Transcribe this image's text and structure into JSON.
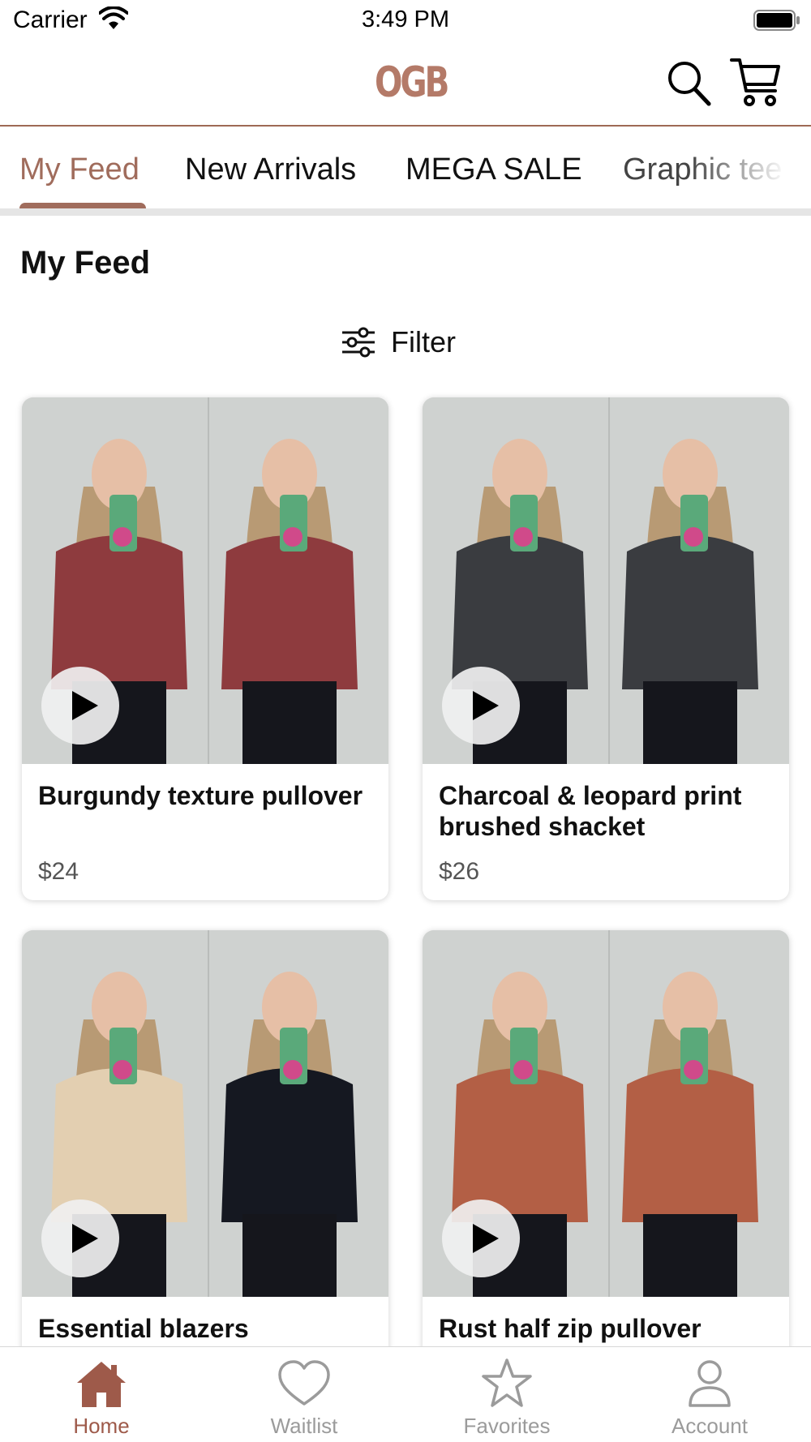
{
  "status_bar": {
    "carrier": "Carrier",
    "time": "3:49 PM"
  },
  "header": {
    "logo": "OGB",
    "brand_color": "#b47a68",
    "icons": [
      "search-icon",
      "cart-icon"
    ]
  },
  "tabs": [
    {
      "label": "My Feed",
      "active": true
    },
    {
      "label": "New Arrivals",
      "active": false
    },
    {
      "label": "MEGA SALE",
      "active": false
    },
    {
      "label": "Graphic tee",
      "active": false
    }
  ],
  "section_title": "My Feed",
  "filter": {
    "label": "Filter",
    "icon": "sliders-icon"
  },
  "products": [
    {
      "name": "Burgundy texture pullover",
      "price": "$24",
      "color": "#8e3b3e"
    },
    {
      "name": "Charcoal & leopard print brushed shacket",
      "price": "$26",
      "color": "#3a3c40"
    },
    {
      "name": "Essential blazers",
      "price": "",
      "color": "#e3cfb1"
    },
    {
      "name": "Rust half zip pullover",
      "price": "",
      "color": "#b35f45"
    }
  ],
  "bottom_nav": [
    {
      "label": "Home",
      "icon": "home-icon",
      "active": true
    },
    {
      "label": "Waitlist",
      "icon": "heart-icon",
      "active": false
    },
    {
      "label": "Favorites",
      "icon": "star-icon",
      "active": false
    },
    {
      "label": "Account",
      "icon": "person-icon",
      "active": false
    }
  ],
  "colors": {
    "accent": "#a06c5c",
    "nav_active": "#9e5a4a",
    "nav_inactive": "#9b9b9b"
  }
}
